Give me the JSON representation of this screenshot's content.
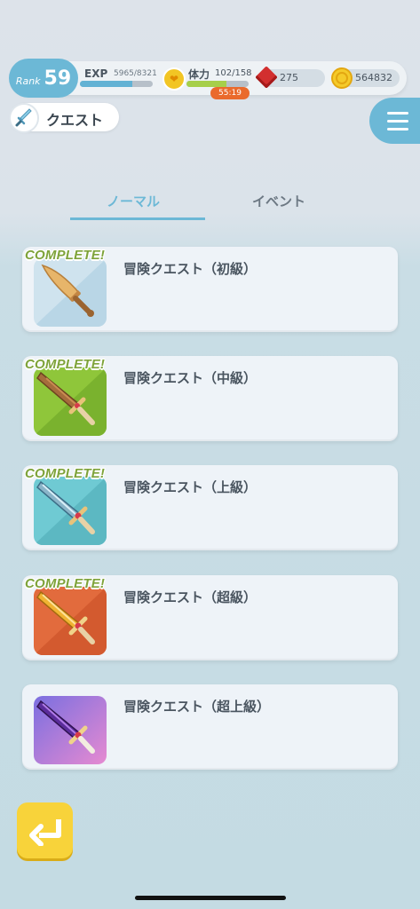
{
  "status": {
    "rank_label": "Rank",
    "rank_value": "59",
    "exp_label": "EXP",
    "exp_value": "5965/8321",
    "exp_progress": 0.717,
    "stamina_label": "体力",
    "stamina_value": "102/158",
    "stamina_progress": 0.646,
    "stamina_timer": "55:19",
    "gems": "275",
    "coins": "564832"
  },
  "header": {
    "title": "クエスト",
    "icon": "sword-icon",
    "menu_icon": "hamburger-menu-icon"
  },
  "tabs": [
    {
      "label": "ノーマル",
      "active": true
    },
    {
      "label": "イベント",
      "active": false
    }
  ],
  "quests": [
    {
      "name": "冒険クエスト（初級）",
      "complete_label": "COMPLETE!",
      "completed": true,
      "icon": "wooden-sword-icon"
    },
    {
      "name": "冒険クエスト（中級）",
      "complete_label": "COMPLETE!",
      "completed": true,
      "icon": "bronze-sword-icon"
    },
    {
      "name": "冒険クエスト（上級）",
      "complete_label": "COMPLETE!",
      "completed": true,
      "icon": "steel-sword-icon"
    },
    {
      "name": "冒険クエスト（超級）",
      "complete_label": "COMPLETE!",
      "completed": true,
      "icon": "golden-sword-icon"
    },
    {
      "name": "冒険クエスト（超上級）",
      "complete_label": "",
      "completed": false,
      "icon": "crystal-sword-icon"
    }
  ],
  "colors": {
    "accent": "#6cb8d6",
    "complete_text": "#7ea33a",
    "timer": "#ea6a2c",
    "back_button": "#f8d33a"
  },
  "back_icon": "return-arrow-icon"
}
